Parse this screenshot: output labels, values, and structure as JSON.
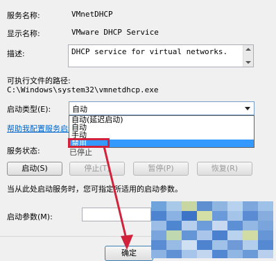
{
  "service_name_label": "服务名称:",
  "service_name": "VMnetDHCP",
  "display_name_label": "显示名称:",
  "display_name": "VMware DHCP Service",
  "description_label": "描述:",
  "description": "DHCP service for virtual networks.",
  "exe_path_label": "可执行文件的路径:",
  "exe_path": "C:\\Windows\\system32\\vmnetdhcp.exe",
  "startup_type_label": "启动类型(E):",
  "startup_type_selected": "自动",
  "startup_options": [
    "自动(延迟启动)",
    "自动",
    "手动",
    "禁用"
  ],
  "help_link": "帮助我配置服务启动",
  "service_status_label": "服务状态:",
  "service_status": "已停止",
  "buttons": {
    "start": "启动(S)",
    "stop": "停止(T)",
    "pause": "暂停(P)",
    "resume": "恢复(R)"
  },
  "hint_text": "当从此处启动服务时，您可指定所适用的启动参数。",
  "start_params_label": "启动参数(M):",
  "ok_button": "确定",
  "colors": {
    "highlight_box": "#d2213a",
    "arrow": "#d2213a",
    "selected_option": "#3399ff",
    "link": "#0066cc"
  }
}
